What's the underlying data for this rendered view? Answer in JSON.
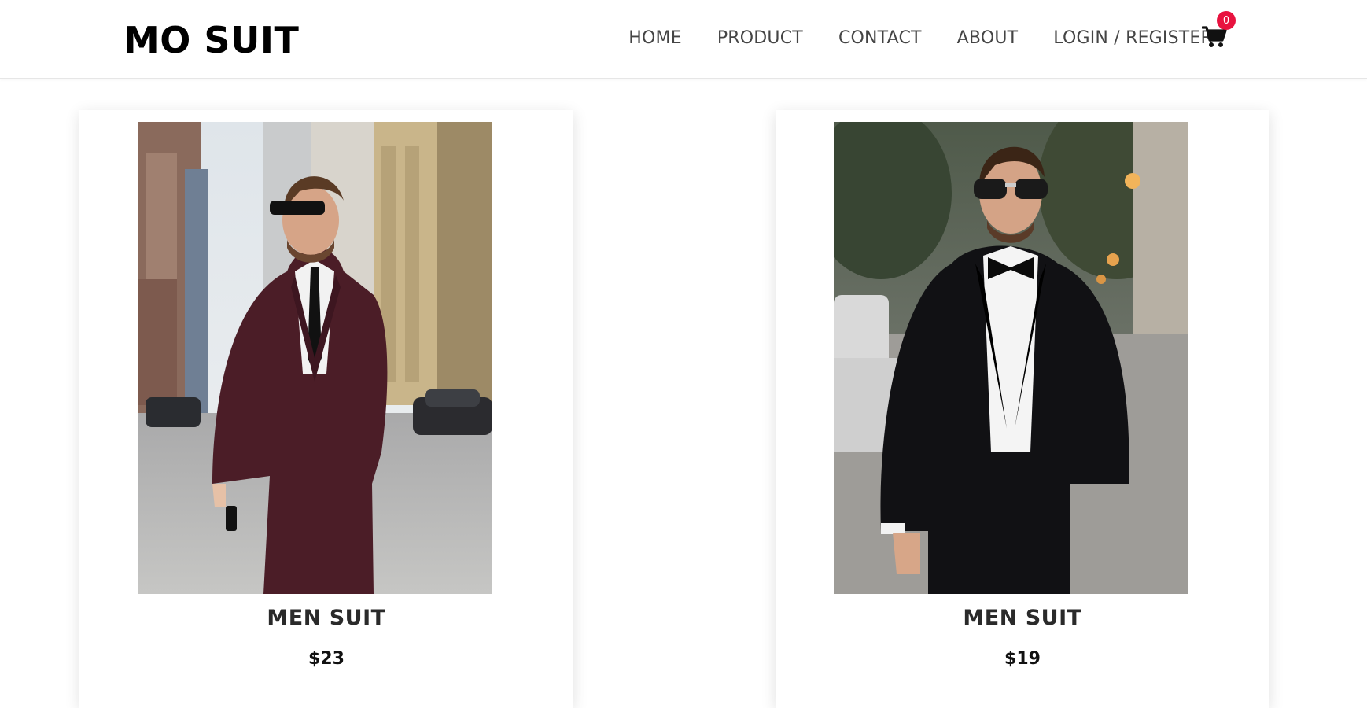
{
  "header": {
    "brand": "MO SUIT",
    "nav": [
      "HOME",
      "PRODUCT",
      "CONTACT",
      "ABOUT",
      "LOGIN / REGISTER"
    ],
    "cart": {
      "icon": "cart-icon",
      "count": "0",
      "badge_color": "#e8123f"
    }
  },
  "products": [
    {
      "title": "MEN SUIT",
      "price": "$23",
      "image": "man-in-burgundy-suit-photo"
    },
    {
      "title": "MEN SUIT",
      "price": "$19",
      "image": "man-in-black-tuxedo-photo"
    }
  ]
}
